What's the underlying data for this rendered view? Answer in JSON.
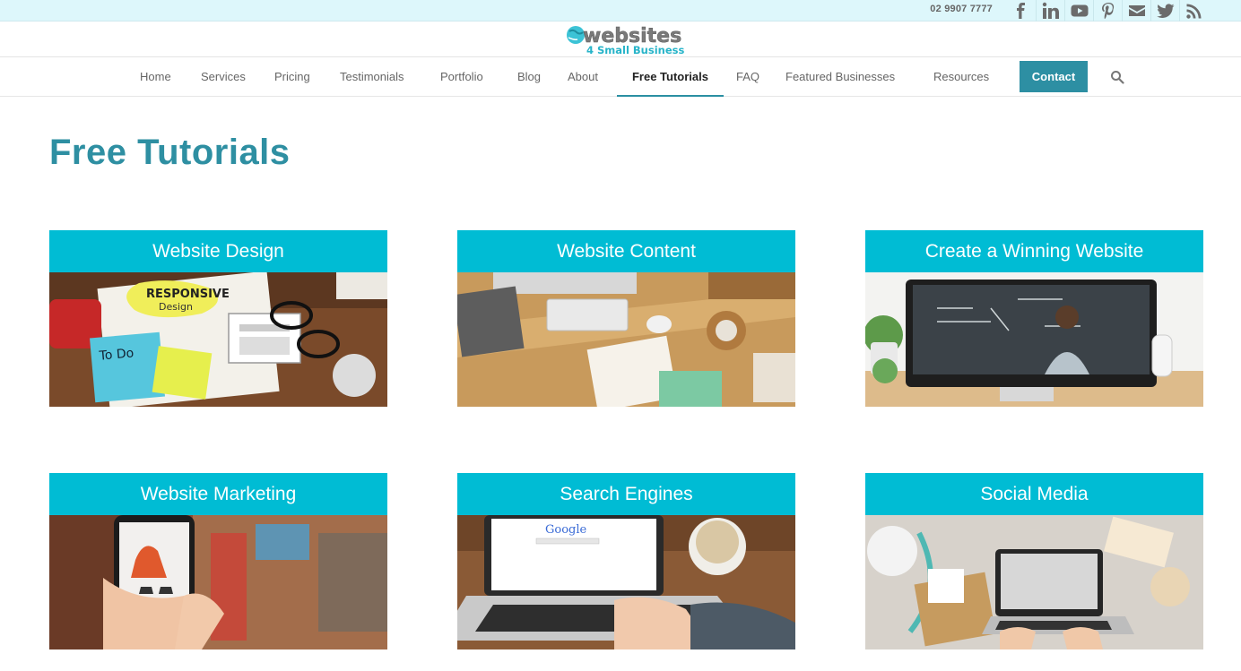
{
  "topbar": {
    "phone": "02 9907 7777",
    "social_icons": [
      "facebook-icon",
      "linkedin-icon",
      "youtube-icon",
      "pinterest-icon",
      "mail-icon",
      "twitter-icon",
      "rss-icon"
    ]
  },
  "logo": {
    "line1": "websites",
    "line2": "4 Small Business"
  },
  "nav": {
    "items": [
      "Home",
      "Services",
      "Pricing",
      "Testimonials",
      "Portfolio",
      "Blog",
      "About",
      "Free Tutorials",
      "FAQ",
      "Featured Businesses",
      "Resources"
    ],
    "active": "Free Tutorials",
    "contact": "Contact",
    "search_icon": "search-icon"
  },
  "page": {
    "title": "Free Tutorials"
  },
  "cards": [
    {
      "title": "Website Design"
    },
    {
      "title": "Website Content"
    },
    {
      "title": "Create a Winning Website"
    },
    {
      "title": "Website Marketing"
    },
    {
      "title": "Search Engines"
    },
    {
      "title": "Social Media"
    }
  ],
  "colors": {
    "accent": "#2e8fa2",
    "card_header": "#00bcd4",
    "topbar_bg": "#ddf7fb"
  }
}
